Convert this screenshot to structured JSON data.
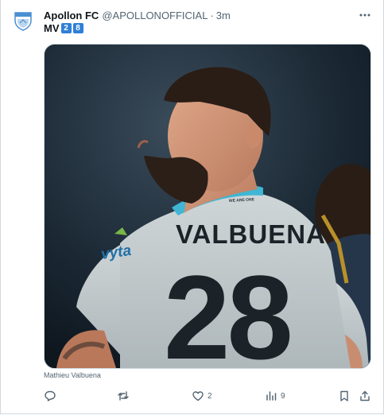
{
  "account": {
    "name": "Apollon FC",
    "handle": "@APOLLONOFFICIAL",
    "separator": "·",
    "time": "3m"
  },
  "tweet": {
    "text_prefix": "MV",
    "number_keys": [
      "2",
      "8"
    ]
  },
  "media": {
    "jersey_name": "VALBUENA",
    "jersey_number": "28",
    "collar_text": "WE ARE ONE",
    "sponsor": "vyta",
    "caption": "Mathieu Valbuena"
  },
  "actions": {
    "reply_count": "",
    "retweet_count": "",
    "like_count": "2",
    "views_count": "9"
  },
  "colors": {
    "accent": "#1d9bf0",
    "muted": "#536471",
    "keycap": "#2f7fd6",
    "collar": "#3fb6d4"
  },
  "icons": [
    "apollon-crest-icon",
    "more-icon",
    "reply-icon",
    "retweet-icon",
    "like-icon",
    "views-icon",
    "bookmark-icon",
    "share-icon"
  ]
}
